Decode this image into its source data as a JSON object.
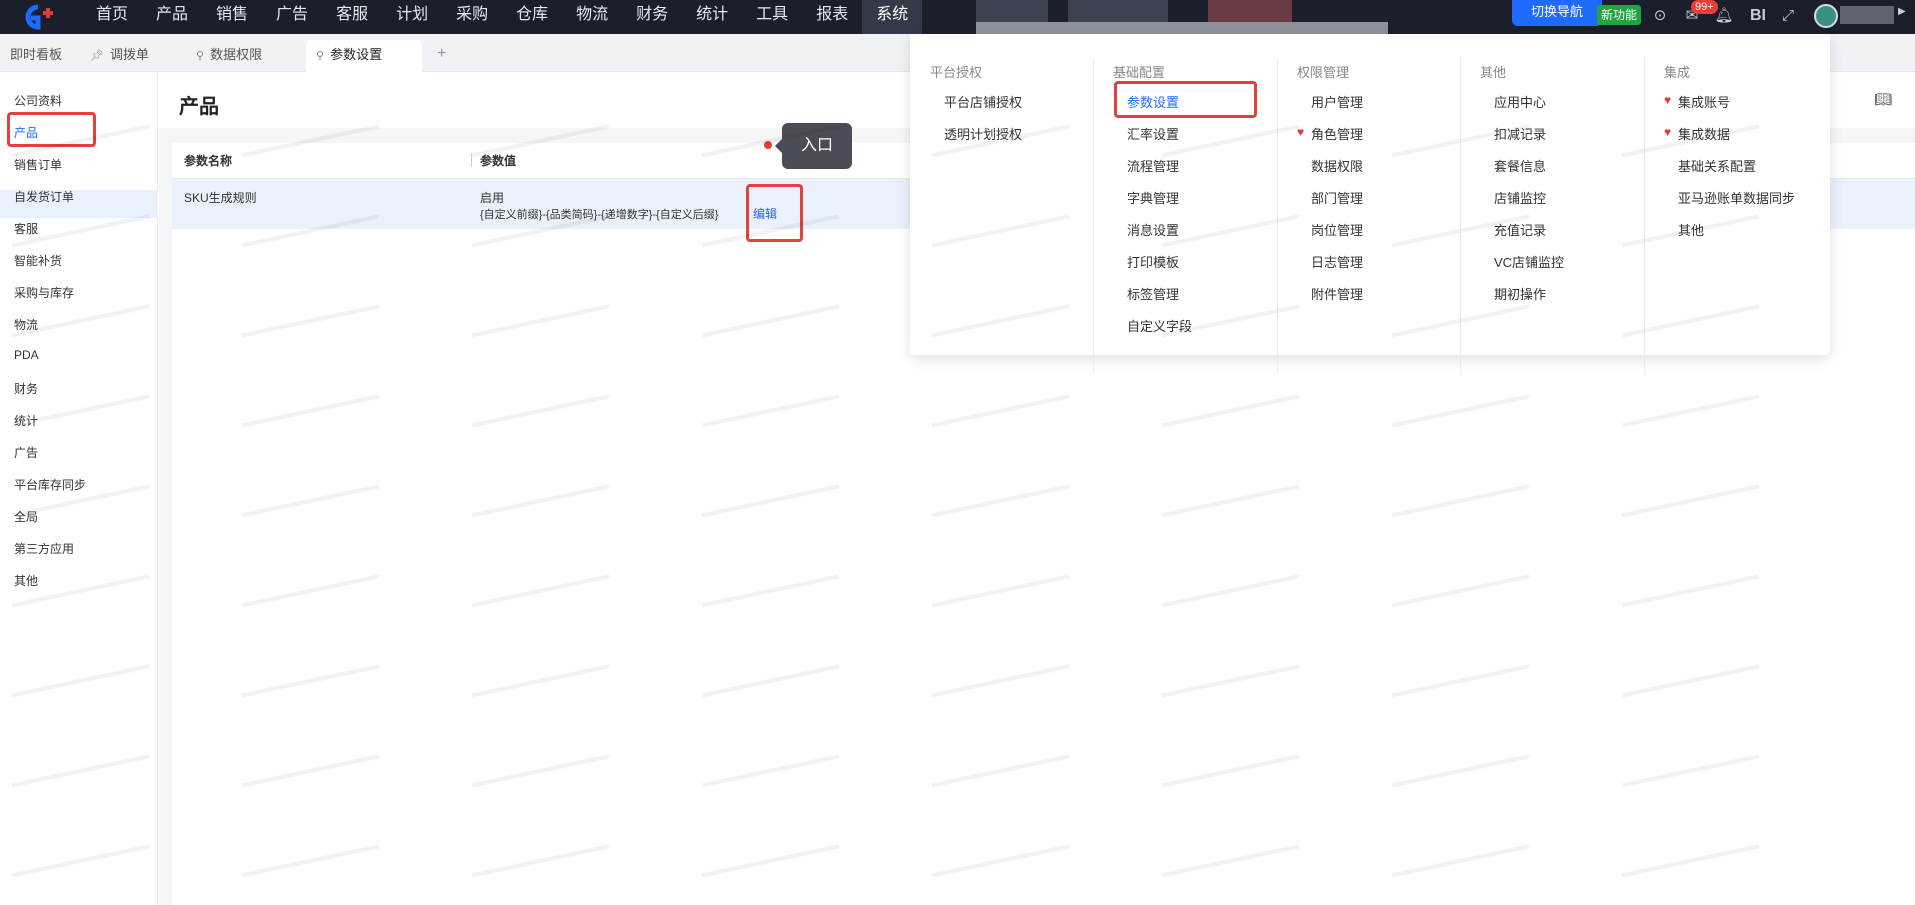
{
  "topnav": {
    "items": [
      "首页",
      "产品",
      "销售",
      "广告",
      "客服",
      "计划",
      "采购",
      "仓库",
      "物流",
      "财务",
      "统计",
      "工具",
      "报表",
      "系统"
    ],
    "active_index": 13,
    "switch_nav_label": "切换导航",
    "new_feature_label": "新功能",
    "message_count": "99+",
    "bi_label": "BI"
  },
  "tabs": [
    {
      "label": "即时看板",
      "active": false
    },
    {
      "label": "调拨单",
      "active": false
    },
    {
      "label": "数据权限",
      "active": false
    },
    {
      "label": "参数设置",
      "active": true
    }
  ],
  "tab_add_label": "+",
  "sidebar": {
    "items": [
      "公司资料",
      "产品",
      "销售订单",
      "自发货订单",
      "客服",
      "智能补货",
      "采购与库存",
      "物流",
      "PDA",
      "财务",
      "统计",
      "广告",
      "平台库存同步",
      "全局",
      "第三方应用",
      "其他"
    ],
    "active_index": 1
  },
  "page": {
    "title": "产品",
    "columns": [
      "参数名称",
      "参数值"
    ],
    "rows": [
      {
        "name": "SKU生成规则",
        "status": "启用",
        "rule": "{自定义前缀}-{品类简码}-{递增数字}-{自定义后缀}",
        "action": "编辑"
      }
    ]
  },
  "callout": {
    "label": "入口"
  },
  "menu": {
    "columns": [
      {
        "title": "平台授权",
        "items": [
          "平台店铺授权",
          "透明计划授权"
        ]
      },
      {
        "title": "基础配置",
        "items": [
          "参数设置",
          "汇率设置",
          "流程管理",
          "字典管理",
          "消息设置",
          "打印模板",
          "标签管理",
          "自定义字段"
        ],
        "active_index": 0
      },
      {
        "title": "权限管理",
        "items": [
          "用户管理",
          "角色管理",
          "数据权限",
          "部门管理",
          "岗位管理",
          "日志管理",
          "附件管理"
        ],
        "hearts": [
          1
        ]
      },
      {
        "title": "其他",
        "items": [
          "应用中心",
          "扣减记录",
          "套餐信息",
          "店铺监控",
          "充值记录",
          "VC店铺监控",
          "期初操作"
        ]
      },
      {
        "title": "集成",
        "items": [
          "集成账号",
          "集成数据",
          "基础关系配置",
          "亚马逊账单数据同步",
          "其他"
        ],
        "hearts": [
          0,
          1
        ]
      }
    ]
  },
  "colors": {
    "accent": "#1f6bff",
    "nav_bg": "#1b1f2b",
    "annotation_red": "#e0433f",
    "new_green": "#23a340"
  }
}
